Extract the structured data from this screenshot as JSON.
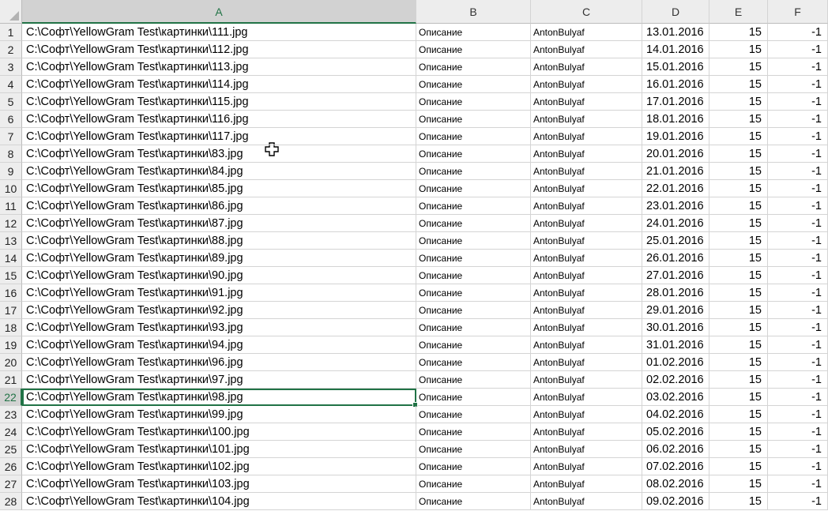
{
  "columns": [
    "A",
    "B",
    "C",
    "D",
    "E",
    "F"
  ],
  "selected_column": "A",
  "selected_row": "22",
  "rows": [
    {
      "n": "1",
      "a": "C:\\Софт\\YellowGram Test\\картинки\\111.jpg",
      "b": "Описание",
      "c": "AntonBulyaf",
      "d": "13.01.2016",
      "e": "15",
      "f": "-1"
    },
    {
      "n": "2",
      "a": "C:\\Софт\\YellowGram Test\\картинки\\112.jpg",
      "b": "Описание",
      "c": "AntonBulyaf",
      "d": "14.01.2016",
      "e": "15",
      "f": "-1"
    },
    {
      "n": "3",
      "a": "C:\\Софт\\YellowGram Test\\картинки\\113.jpg",
      "b": "Описание",
      "c": "AntonBulyaf",
      "d": "15.01.2016",
      "e": "15",
      "f": "-1"
    },
    {
      "n": "4",
      "a": "C:\\Софт\\YellowGram Test\\картинки\\114.jpg",
      "b": "Описание",
      "c": "AntonBulyaf",
      "d": "16.01.2016",
      "e": "15",
      "f": "-1"
    },
    {
      "n": "5",
      "a": "C:\\Софт\\YellowGram Test\\картинки\\115.jpg",
      "b": "Описание",
      "c": "AntonBulyaf",
      "d": "17.01.2016",
      "e": "15",
      "f": "-1"
    },
    {
      "n": "6",
      "a": "C:\\Софт\\YellowGram Test\\картинки\\116.jpg",
      "b": "Описание",
      "c": "AntonBulyaf",
      "d": "18.01.2016",
      "e": "15",
      "f": "-1"
    },
    {
      "n": "7",
      "a": "C:\\Софт\\YellowGram Test\\картинки\\117.jpg",
      "b": "Описание",
      "c": "AntonBulyaf",
      "d": "19.01.2016",
      "e": "15",
      "f": "-1"
    },
    {
      "n": "8",
      "a": "C:\\Софт\\YellowGram Test\\картинки\\83.jpg",
      "b": "Описание",
      "c": "AntonBulyaf",
      "d": "20.01.2016",
      "e": "15",
      "f": "-1"
    },
    {
      "n": "9",
      "a": "C:\\Софт\\YellowGram Test\\картинки\\84.jpg",
      "b": "Описание",
      "c": "AntonBulyaf",
      "d": "21.01.2016",
      "e": "15",
      "f": "-1"
    },
    {
      "n": "10",
      "a": "C:\\Софт\\YellowGram Test\\картинки\\85.jpg",
      "b": "Описание",
      "c": "AntonBulyaf",
      "d": "22.01.2016",
      "e": "15",
      "f": "-1"
    },
    {
      "n": "11",
      "a": "C:\\Софт\\YellowGram Test\\картинки\\86.jpg",
      "b": "Описание",
      "c": "AntonBulyaf",
      "d": "23.01.2016",
      "e": "15",
      "f": "-1"
    },
    {
      "n": "12",
      "a": "C:\\Софт\\YellowGram Test\\картинки\\87.jpg",
      "b": "Описание",
      "c": "AntonBulyaf",
      "d": "24.01.2016",
      "e": "15",
      "f": "-1"
    },
    {
      "n": "13",
      "a": "C:\\Софт\\YellowGram Test\\картинки\\88.jpg",
      "b": "Описание",
      "c": "AntonBulyaf",
      "d": "25.01.2016",
      "e": "15",
      "f": "-1"
    },
    {
      "n": "14",
      "a": "C:\\Софт\\YellowGram Test\\картинки\\89.jpg",
      "b": "Описание",
      "c": "AntonBulyaf",
      "d": "26.01.2016",
      "e": "15",
      "f": "-1"
    },
    {
      "n": "15",
      "a": "C:\\Софт\\YellowGram Test\\картинки\\90.jpg",
      "b": "Описание",
      "c": "AntonBulyaf",
      "d": "27.01.2016",
      "e": "15",
      "f": "-1"
    },
    {
      "n": "16",
      "a": "C:\\Софт\\YellowGram Test\\картинки\\91.jpg",
      "b": "Описание",
      "c": "AntonBulyaf",
      "d": "28.01.2016",
      "e": "15",
      "f": "-1"
    },
    {
      "n": "17",
      "a": "C:\\Софт\\YellowGram Test\\картинки\\92.jpg",
      "b": "Описание",
      "c": "AntonBulyaf",
      "d": "29.01.2016",
      "e": "15",
      "f": "-1"
    },
    {
      "n": "18",
      "a": "C:\\Софт\\YellowGram Test\\картинки\\93.jpg",
      "b": "Описание",
      "c": "AntonBulyaf",
      "d": "30.01.2016",
      "e": "15",
      "f": "-1"
    },
    {
      "n": "19",
      "a": "C:\\Софт\\YellowGram Test\\картинки\\94.jpg",
      "b": "Описание",
      "c": "AntonBulyaf",
      "d": "31.01.2016",
      "e": "15",
      "f": "-1"
    },
    {
      "n": "20",
      "a": "C:\\Софт\\YellowGram Test\\картинки\\96.jpg",
      "b": "Описание",
      "c": "AntonBulyaf",
      "d": "01.02.2016",
      "e": "15",
      "f": "-1"
    },
    {
      "n": "21",
      "a": "C:\\Софт\\YellowGram Test\\картинки\\97.jpg",
      "b": "Описание",
      "c": "AntonBulyaf",
      "d": "02.02.2016",
      "e": "15",
      "f": "-1"
    },
    {
      "n": "22",
      "a": "C:\\Софт\\YellowGram Test\\картинки\\98.jpg",
      "b": "Описание",
      "c": "AntonBulyaf",
      "d": "03.02.2016",
      "e": "15",
      "f": "-1"
    },
    {
      "n": "23",
      "a": "C:\\Софт\\YellowGram Test\\картинки\\99.jpg",
      "b": "Описание",
      "c": "AntonBulyaf",
      "d": "04.02.2016",
      "e": "15",
      "f": "-1"
    },
    {
      "n": "24",
      "a": "C:\\Софт\\YellowGram Test\\картинки\\100.jpg",
      "b": "Описание",
      "c": "AntonBulyaf",
      "d": "05.02.2016",
      "e": "15",
      "f": "-1"
    },
    {
      "n": "25",
      "a": "C:\\Софт\\YellowGram Test\\картинки\\101.jpg",
      "b": "Описание",
      "c": "AntonBulyaf",
      "d": "06.02.2016",
      "e": "15",
      "f": "-1"
    },
    {
      "n": "26",
      "a": "C:\\Софт\\YellowGram Test\\картинки\\102.jpg",
      "b": "Описание",
      "c": "AntonBulyaf",
      "d": "07.02.2016",
      "e": "15",
      "f": "-1"
    },
    {
      "n": "27",
      "a": "C:\\Софт\\YellowGram Test\\картинки\\103.jpg",
      "b": "Описание",
      "c": "AntonBulyaf",
      "d": "08.02.2016",
      "e": "15",
      "f": "-1"
    },
    {
      "n": "28",
      "a": "C:\\Софт\\YellowGram Test\\картинки\\104.jpg",
      "b": "Описание",
      "c": "AntonBulyaf",
      "d": "09.02.2016",
      "e": "15",
      "f": "-1"
    }
  ],
  "colors": {
    "accent": "#217346",
    "header_bg": "#ededed",
    "header_selected_bg": "#d2d2d2",
    "gridline": "#d4d4d4"
  },
  "icons": {
    "cursor": "cell-select-cursor-icon"
  }
}
